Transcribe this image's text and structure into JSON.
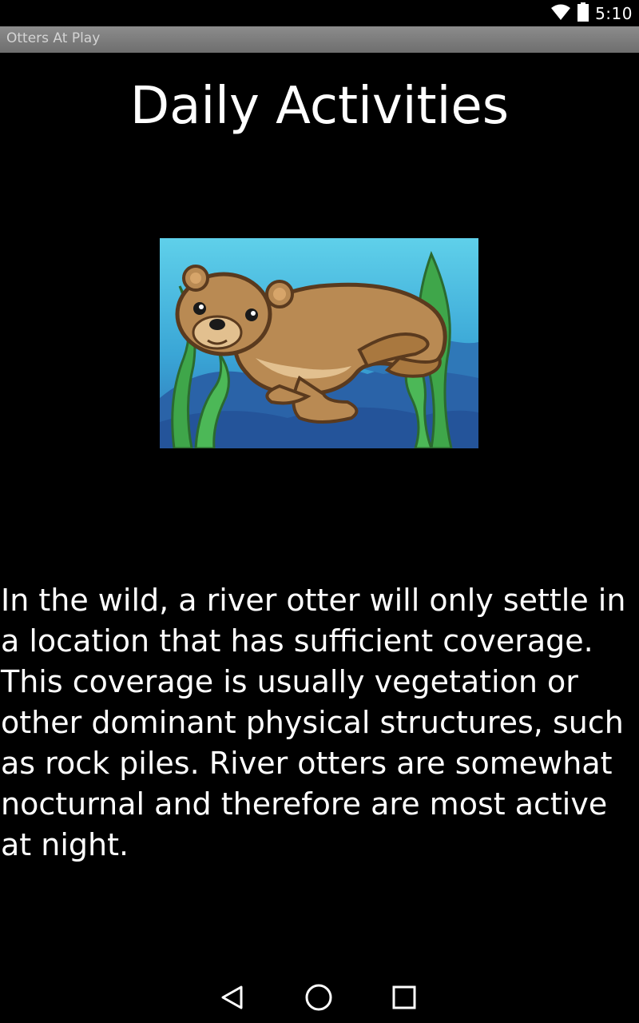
{
  "status_bar": {
    "time": "5:10",
    "icons": [
      "wifi-icon",
      "battery-icon"
    ]
  },
  "app": {
    "title": "Otters At Play"
  },
  "main": {
    "heading": "Daily Activities",
    "body": "In the wild, a river otter will only settle in a location that has sufficient coverage. This coverage is usually vegetation or other dominant physical structures, such as rock piles. River otters are somewhat nocturnal and therefore are most active at night."
  },
  "nav_bar": {
    "buttons": [
      "back-icon",
      "home-icon",
      "recents-icon"
    ]
  },
  "colors": {
    "background": "#000000",
    "title_bar": "#7d7d7d",
    "title_text": "#d4d4d4",
    "text": "#ffffff",
    "illustration_water": "#3ea3d1",
    "otter_fur": "#b98a53"
  }
}
